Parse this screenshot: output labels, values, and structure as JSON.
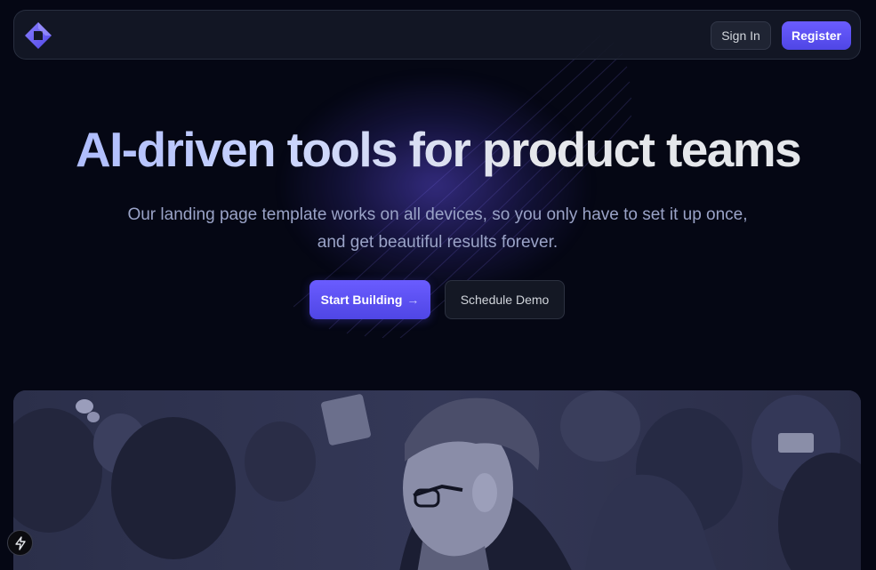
{
  "header": {
    "logo_icon": "diamond-logo-icon",
    "sign_in_label": "Sign In",
    "register_label": "Register"
  },
  "hero": {
    "title": "AI-driven tools for product teams",
    "subtitle_line1": "Our landing page template works on all devices, so you only have to set it up once,",
    "subtitle_line2": "and get beautiful results forever.",
    "primary_cta": "Start Building",
    "primary_cta_icon": "arrow-right-icon",
    "secondary_cta": "Schedule Demo"
  },
  "image": {
    "subject": "person-with-glasses-photo"
  },
  "colors": {
    "accent": "#5b4ff0",
    "background": "#050714",
    "surface": "#141824"
  },
  "dev_badge": {
    "icon": "lightning-icon"
  }
}
